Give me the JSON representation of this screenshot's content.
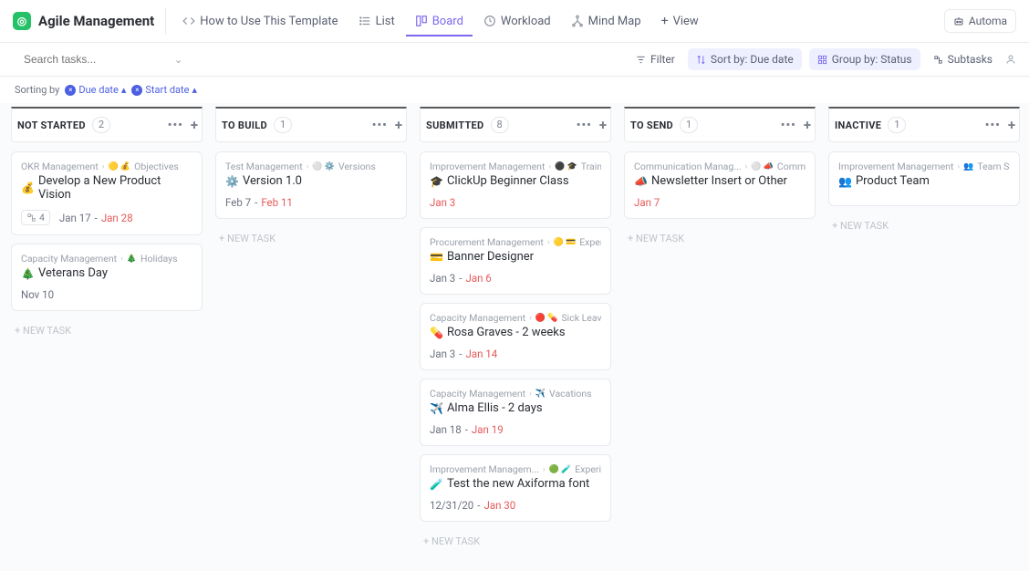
{
  "workspace": {
    "name": "Agile Management"
  },
  "views": {
    "howto": "How to Use This Template",
    "list": "List",
    "board": "Board",
    "workload": "Workload",
    "mindmap": "Mind Map",
    "addView": "View"
  },
  "topRight": {
    "automations": "Automa"
  },
  "toolbar": {
    "searchPlaceholder": "Search tasks...",
    "filter": "Filter",
    "sortBy": "Sort by: Due date",
    "groupBy": "Group by: Status",
    "subtasks": "Subtasks"
  },
  "sorting": {
    "label": "Sorting by",
    "chips": [
      "Due date",
      "Start date"
    ]
  },
  "columns": [
    {
      "title": "NOT STARTED",
      "count": "2",
      "cards": [
        {
          "crumb1": "OKR Management",
          "crumb2": "Objectives",
          "icons": "🟡 💰",
          "titleIcon": "💰",
          "title": "Develop a New Product Vision",
          "subCount": "4",
          "start": "Jan 17",
          "due": "Jan 28"
        },
        {
          "crumb1": "Capacity Management",
          "crumb2": "Holidays",
          "icons": "🎄",
          "titleIcon": "🎄",
          "title": "Veterans Day",
          "start": "Nov 10",
          "due": ""
        }
      ]
    },
    {
      "title": "TO BUILD",
      "count": "1",
      "cards": [
        {
          "crumb1": "Test Management",
          "crumb2": "Versions",
          "icons": "⚪ ⚙️",
          "titleIcon": "⚙️",
          "title": "Version 1.0",
          "start": "Feb 7",
          "due": "Feb 11"
        }
      ]
    },
    {
      "title": "SUBMITTED",
      "count": "8",
      "cards": [
        {
          "crumb1": "Improvement Management",
          "crumb2": "Trainings",
          "icons": "⚫ 🎓",
          "titleIcon": "🎓",
          "title": "ClickUp Beginner Class",
          "start": "",
          "due": "Jan 3"
        },
        {
          "crumb1": "Procurement Management",
          "crumb2": "Expenses",
          "icons": "🟡 💳",
          "titleIcon": "💳",
          "title": "Banner Designer",
          "start": "Jan 3",
          "due": "Jan 6"
        },
        {
          "crumb1": "Capacity Management",
          "crumb2": "Sick Leave",
          "icons": "🔴 💊",
          "titleIcon": "💊",
          "title": "Rosa Graves - 2 weeks",
          "start": "Jan 3",
          "due": "Jan 14"
        },
        {
          "crumb1": "Capacity Management",
          "crumb2": "Vacations",
          "icons": "✈️",
          "titleIcon": "✈️",
          "title": "Alma Ellis - 2 days",
          "start": "Jan 18",
          "due": "Jan 19"
        },
        {
          "crumb1": "Improvement Managem...",
          "crumb2": "Experime...",
          "icons": "🟢 🧪",
          "titleIcon": "🧪",
          "title": "Test the new Axiforma font",
          "start": "12/31/20",
          "due": "Jan 30"
        }
      ]
    },
    {
      "title": "TO SEND",
      "count": "1",
      "cards": [
        {
          "crumb1": "Communication Manag...",
          "crumb2": "Communica...",
          "icons": "⚪ 📣",
          "titleIcon": "📣",
          "title": "Newsletter Insert or Other",
          "start": "",
          "due": "Jan 7"
        }
      ]
    },
    {
      "title": "INACTIVE",
      "count": "1",
      "cards": [
        {
          "crumb1": "Improvement Management",
          "crumb2": "Team Status",
          "icons": "👥",
          "titleIcon": "👥",
          "title": "Product Team",
          "start": "",
          "due": ""
        }
      ]
    }
  ],
  "newTask": "+ NEW TASK"
}
